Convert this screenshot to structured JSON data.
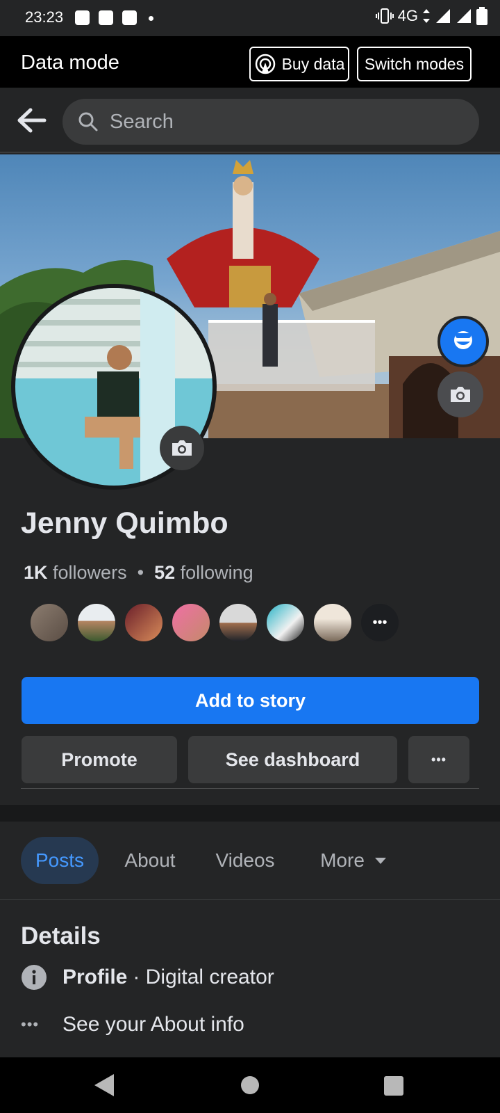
{
  "status_bar": {
    "time": "23:23",
    "network": "4G"
  },
  "data_mode": {
    "title": "Data mode",
    "buy_data": "Buy data",
    "switch_modes": "Switch modes"
  },
  "search": {
    "placeholder": "Search"
  },
  "profile": {
    "name": "Jenny Quimbo",
    "followers_count": "1K",
    "followers_label": "followers",
    "separator": "•",
    "following_count": "52",
    "following_label": "following"
  },
  "actions": {
    "add_story": "Add to story",
    "promote": "Promote",
    "dashboard": "See dashboard",
    "more": "•••"
  },
  "tabs": [
    {
      "label": "Posts",
      "active": true
    },
    {
      "label": "About"
    },
    {
      "label": "Videos"
    },
    {
      "label": "More"
    }
  ],
  "details": {
    "title": "Details",
    "profile_label": "Profile",
    "profile_value": "· Digital creator",
    "about_info": "See your About info"
  },
  "colors": {
    "accent": "#1877f2",
    "background": "#242526",
    "surface": "#3a3b3c"
  }
}
